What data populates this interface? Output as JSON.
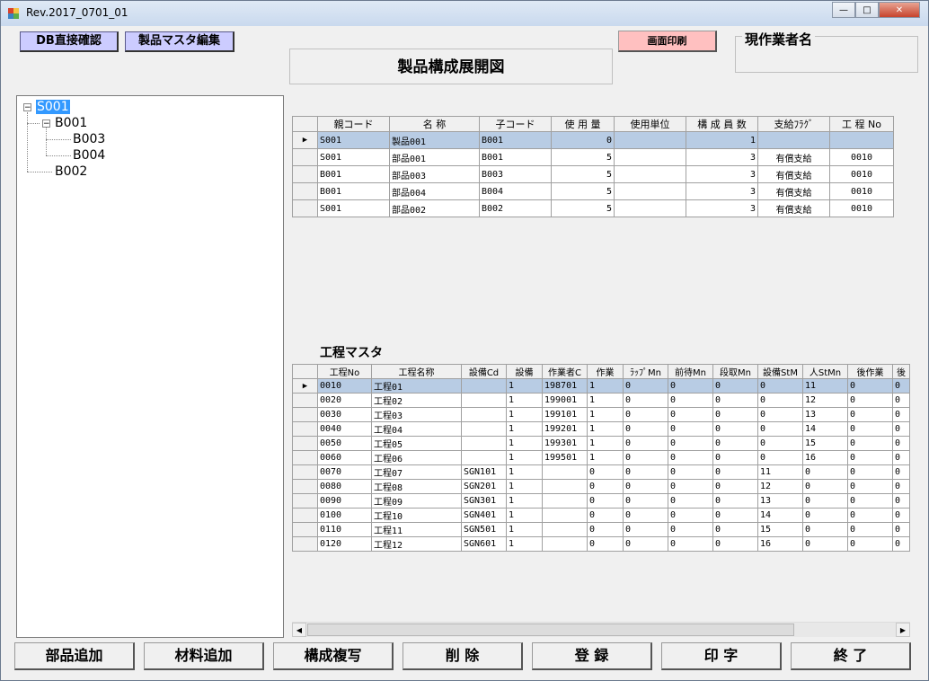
{
  "window": {
    "title": "Rev.2017_0701_01",
    "min": "—",
    "max": "□",
    "close": "✕"
  },
  "toolbar": {
    "db_check": "DB直接確認",
    "product_master": "製品マスタ編集",
    "print_screen": "画面印刷"
  },
  "heading": "製品構成展開図",
  "worker": {
    "label": "現作業者名",
    "value": ""
  },
  "tree": {
    "root": "S001",
    "b001": "B001",
    "b003": "B003",
    "b004": "B004",
    "b002": "B002"
  },
  "bom": {
    "columns": [
      "親コード",
      "名 称",
      "子コード",
      "使 用 量",
      "使用単位",
      "構 成 員 数",
      "支給ﾌﾗｸﾞ",
      "工 程 No"
    ],
    "rows": [
      [
        "S001",
        "製品001",
        "B001",
        "0",
        "",
        "1",
        "",
        ""
      ],
      [
        "S001",
        "部品001",
        "B001",
        "5",
        "",
        "3",
        "有償支給",
        "0010"
      ],
      [
        "B001",
        "部品003",
        "B003",
        "5",
        "",
        "3",
        "有償支給",
        "0010"
      ],
      [
        "B001",
        "部品004",
        "B004",
        "5",
        "",
        "3",
        "有償支給",
        "0010"
      ],
      [
        "S001",
        "部品002",
        "B002",
        "5",
        "",
        "3",
        "有償支給",
        "0010"
      ]
    ]
  },
  "process": {
    "title": "工程マスタ",
    "columns": [
      "工程No",
      "工程名称",
      "設備Cd",
      "設備",
      "作業者C",
      "作業",
      "ﾗｯﾌﾟMn",
      "前待Mn",
      "段取Mn",
      "設備StM",
      "人StMn",
      "後作業",
      "後"
    ],
    "rows": [
      [
        "0010",
        "工程01",
        "",
        "1",
        "198701",
        "1",
        "0",
        "0",
        "0",
        "0",
        "11",
        "0",
        "0"
      ],
      [
        "0020",
        "工程02",
        "",
        "1",
        "199001",
        "1",
        "0",
        "0",
        "0",
        "0",
        "12",
        "0",
        "0"
      ],
      [
        "0030",
        "工程03",
        "",
        "1",
        "199101",
        "1",
        "0",
        "0",
        "0",
        "0",
        "13",
        "0",
        "0"
      ],
      [
        "0040",
        "工程04",
        "",
        "1",
        "199201",
        "1",
        "0",
        "0",
        "0",
        "0",
        "14",
        "0",
        "0"
      ],
      [
        "0050",
        "工程05",
        "",
        "1",
        "199301",
        "1",
        "0",
        "0",
        "0",
        "0",
        "15",
        "0",
        "0"
      ],
      [
        "0060",
        "工程06",
        "",
        "1",
        "199501",
        "1",
        "0",
        "0",
        "0",
        "0",
        "16",
        "0",
        "0"
      ],
      [
        "0070",
        "工程07",
        "SGN101",
        "1",
        "",
        "0",
        "0",
        "0",
        "0",
        "11",
        "0",
        "0",
        "0"
      ],
      [
        "0080",
        "工程08",
        "SGN201",
        "1",
        "",
        "0",
        "0",
        "0",
        "0",
        "12",
        "0",
        "0",
        "0"
      ],
      [
        "0090",
        "工程09",
        "SGN301",
        "1",
        "",
        "0",
        "0",
        "0",
        "0",
        "13",
        "0",
        "0",
        "0"
      ],
      [
        "0100",
        "工程10",
        "SGN401",
        "1",
        "",
        "0",
        "0",
        "0",
        "0",
        "14",
        "0",
        "0",
        "0"
      ],
      [
        "0110",
        "工程11",
        "SGN501",
        "1",
        "",
        "0",
        "0",
        "0",
        "0",
        "15",
        "0",
        "0",
        "0"
      ],
      [
        "0120",
        "工程12",
        "SGN601",
        "1",
        "",
        "0",
        "0",
        "0",
        "0",
        "16",
        "0",
        "0",
        "0"
      ]
    ]
  },
  "selected_row_marker": "▶",
  "buttons": {
    "add_part": "部品追加",
    "add_material": "材料追加",
    "copy_structure": "構成複写",
    "delete": "削 除",
    "register": "登 録",
    "print": "印 字",
    "exit": "終 了"
  }
}
